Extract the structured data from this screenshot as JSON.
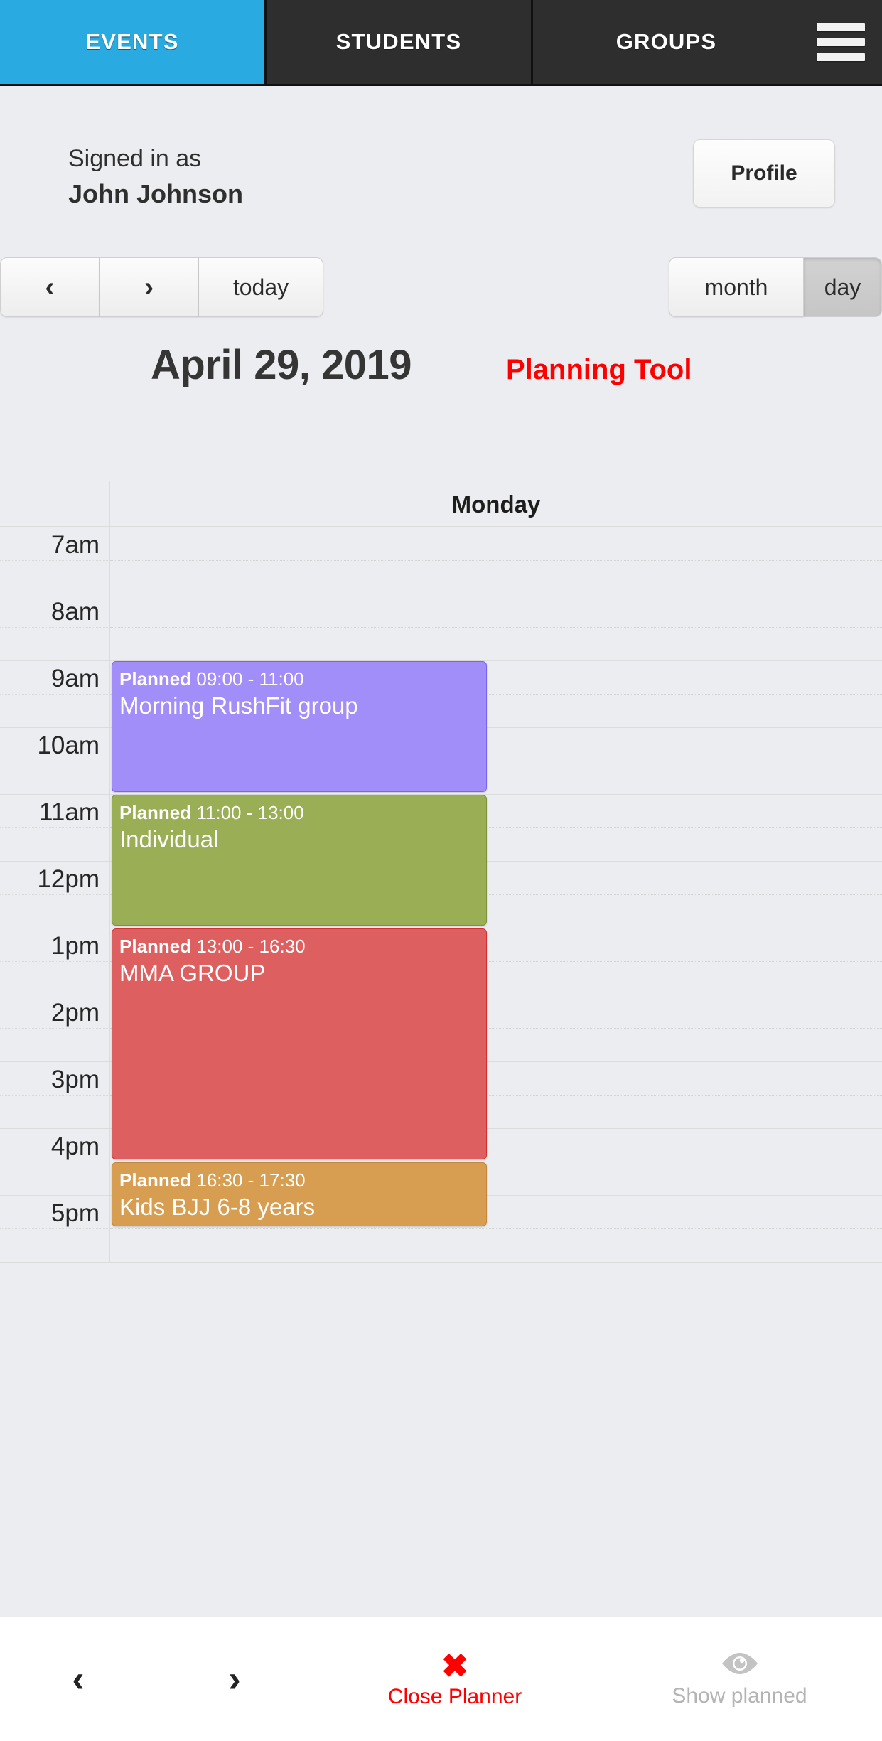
{
  "tabs": [
    {
      "id": "events",
      "label": "EVENTS",
      "active": true
    },
    {
      "id": "students",
      "label": "STUDENTS",
      "active": false
    },
    {
      "id": "groups",
      "label": "GROUPS",
      "active": false
    }
  ],
  "menu_icon": "hamburger-icon",
  "account": {
    "signed_in_label": "Signed in as",
    "user_name": "John Johnson",
    "profile_button": "Profile"
  },
  "toolbar": {
    "prev_label": "‹",
    "next_label": "›",
    "today_label": "today",
    "month_label": "month",
    "day_label": "day",
    "active_view": "day"
  },
  "header": {
    "title": "April 29, 2019",
    "planning_tool_label": "Planning Tool",
    "planning_tool_color": "#ff0000"
  },
  "calendar": {
    "day_header": "Monday",
    "hours": [
      "7am",
      "8am",
      "9am",
      "10am",
      "11am",
      "12pm",
      "1pm",
      "2pm",
      "3pm",
      "4pm",
      "5pm"
    ],
    "first_hour": 7,
    "events": [
      {
        "status": "Planned",
        "time_range": "09:00 - 11:00",
        "start": "09:00",
        "end": "11:00",
        "title": "Morning RushFit group",
        "color": "#a18ef8",
        "border_color": "#7b63ef"
      },
      {
        "status": "Planned",
        "time_range": "11:00 - 13:00",
        "start": "11:00",
        "end": "13:00",
        "title": "Individual",
        "color": "#9aae55",
        "border_color": "#7e9140"
      },
      {
        "status": "Planned",
        "time_range": "13:00 - 16:30",
        "start": "13:00",
        "end": "16:30",
        "title": "MMA GROUP",
        "color": "#dd5f5f",
        "border_color": "#d32f2f"
      },
      {
        "status": "Planned",
        "time_range": "16:30 - 17:30",
        "start": "16:30",
        "end": "17:30",
        "title": "Kids BJJ 6-8 years",
        "color": "#d79d51",
        "border_color": "#c4863a"
      }
    ]
  },
  "bottombar": {
    "prev_label": "‹",
    "next_label": "›",
    "close_icon": "✖",
    "close_label": "Close Planner",
    "show_icon": "eye-icon",
    "show_label": "Show planned"
  }
}
